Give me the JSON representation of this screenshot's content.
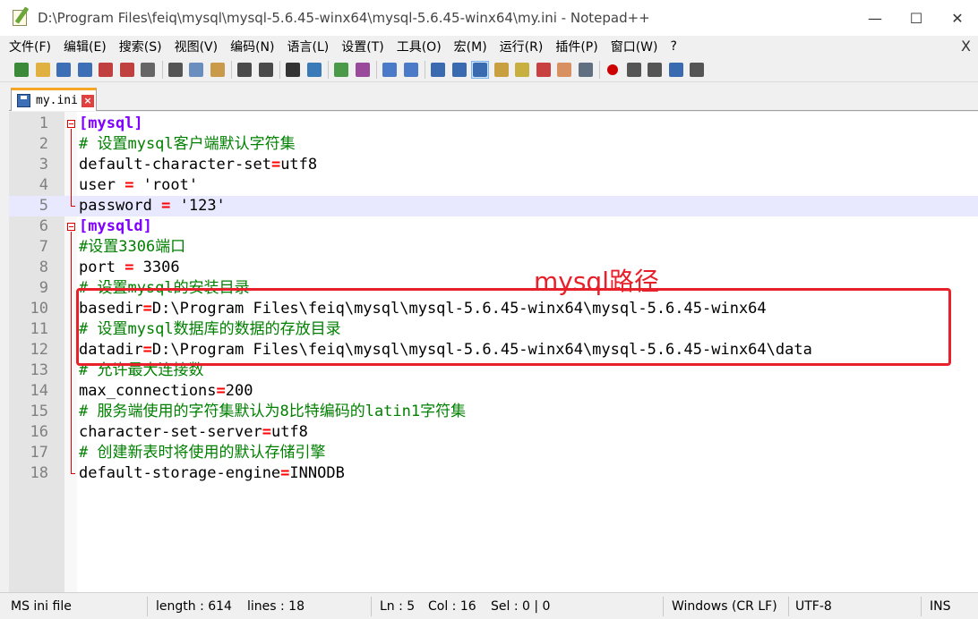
{
  "window": {
    "title": "D:\\Program Files\\feiq\\mysql\\mysql-5.6.45-winx64\\mysql-5.6.45-winx64\\my.ini - Notepad++",
    "minimize": "—",
    "maximize": "☐",
    "close": "✕"
  },
  "menu": {
    "items": [
      "文件(F)",
      "编辑(E)",
      "搜索(S)",
      "视图(V)",
      "编码(N)",
      "语言(L)",
      "设置(T)",
      "工具(O)",
      "宏(M)",
      "运行(R)",
      "插件(P)",
      "窗口(W)",
      "?"
    ],
    "close": "X"
  },
  "toolbar": {
    "icons": [
      {
        "name": "new-file-icon",
        "color": "#3a8a3a"
      },
      {
        "name": "open-file-icon",
        "color": "#e0b040"
      },
      {
        "name": "save-icon",
        "color": "#3d6fb6"
      },
      {
        "name": "save-all-icon",
        "color": "#3d6fb6"
      },
      {
        "name": "close-icon",
        "color": "#c04040"
      },
      {
        "name": "close-all-icon",
        "color": "#c04040"
      },
      {
        "name": "print-icon",
        "color": "#666666"
      },
      {
        "name": "cut-icon",
        "color": "#555555"
      },
      {
        "name": "copy-icon",
        "color": "#6a8fbf"
      },
      {
        "name": "paste-icon",
        "color": "#c89a4a"
      },
      {
        "name": "undo-icon",
        "color": "#4a4a4a"
      },
      {
        "name": "redo-icon",
        "color": "#4a4a4a"
      },
      {
        "name": "find-icon",
        "color": "#333333"
      },
      {
        "name": "replace-icon",
        "color": "#3a7ab8"
      },
      {
        "name": "zoom-in-icon",
        "color": "#4a9a4a"
      },
      {
        "name": "zoom-out-icon",
        "color": "#9a4a9a"
      },
      {
        "name": "sync-vertical-icon",
        "color": "#4a7ac8"
      },
      {
        "name": "sync-horizontal-icon",
        "color": "#4a7ac8"
      },
      {
        "name": "word-wrap-icon",
        "color": "#3a6ab0"
      },
      {
        "name": "show-all-chars-icon",
        "color": "#3a6ab0"
      },
      {
        "name": "indent-guide-icon",
        "color": "#3a6ab0"
      },
      {
        "name": "user-defined-lang-icon",
        "color": "#c8a040"
      },
      {
        "name": "doc-map-icon",
        "color": "#c8b040"
      },
      {
        "name": "function-list-icon",
        "color": "#c84040"
      },
      {
        "name": "folder-as-workspace-icon",
        "color": "#d89060"
      },
      {
        "name": "monitoring-icon",
        "color": "#607080"
      },
      {
        "name": "record-macro-icon",
        "color": "#cc0000"
      },
      {
        "name": "stop-macro-icon",
        "color": "#555555"
      },
      {
        "name": "play-macro-icon",
        "color": "#555555"
      },
      {
        "name": "run-macro-multiple-icon",
        "color": "#3a6ab0"
      },
      {
        "name": "save-macro-icon",
        "color": "#555555"
      }
    ]
  },
  "tab": {
    "label": "my.ini",
    "close": "×"
  },
  "editor": {
    "current_line": 5,
    "lines": [
      {
        "n": "1",
        "parts": [
          {
            "t": "[mysql]",
            "c": "section"
          }
        ]
      },
      {
        "n": "2",
        "parts": [
          {
            "t": "# 设置mysql客户端默认字符集",
            "c": "comment"
          }
        ]
      },
      {
        "n": "3",
        "parts": [
          {
            "t": "default-character-set",
            "c": "key"
          },
          {
            "t": "=",
            "c": "op"
          },
          {
            "t": "utf8",
            "c": "key"
          }
        ]
      },
      {
        "n": "4",
        "parts": [
          {
            "t": "user ",
            "c": "key"
          },
          {
            "t": "=",
            "c": "op"
          },
          {
            "t": " 'root'",
            "c": "key"
          }
        ]
      },
      {
        "n": "5",
        "parts": [
          {
            "t": "password ",
            "c": "key"
          },
          {
            "t": "=",
            "c": "op"
          },
          {
            "t": " '123'",
            "c": "key"
          }
        ]
      },
      {
        "n": "6",
        "parts": [
          {
            "t": "[mysqld]",
            "c": "section"
          }
        ]
      },
      {
        "n": "7",
        "parts": [
          {
            "t": "#设置3306端口",
            "c": "comment"
          }
        ]
      },
      {
        "n": "8",
        "parts": [
          {
            "t": "port ",
            "c": "key"
          },
          {
            "t": "=",
            "c": "op"
          },
          {
            "t": " 3306",
            "c": "key"
          }
        ]
      },
      {
        "n": "9",
        "parts": [
          {
            "t": "# 设置mysql的安装目录",
            "c": "comment"
          }
        ]
      },
      {
        "n": "10",
        "parts": [
          {
            "t": "basedir",
            "c": "key"
          },
          {
            "t": "=",
            "c": "op"
          },
          {
            "t": "D:\\Program Files\\feiq\\mysql\\mysql-5.6.45-winx64\\mysql-5.6.45-winx64",
            "c": "key"
          }
        ]
      },
      {
        "n": "11",
        "parts": [
          {
            "t": "# 设置mysql数据库的数据的存放目录",
            "c": "comment"
          }
        ]
      },
      {
        "n": "12",
        "parts": [
          {
            "t": "datadir",
            "c": "key"
          },
          {
            "t": "=",
            "c": "op"
          },
          {
            "t": "D:\\Program Files\\feiq\\mysql\\mysql-5.6.45-winx64\\mysql-5.6.45-winx64\\data",
            "c": "key"
          }
        ]
      },
      {
        "n": "13",
        "parts": [
          {
            "t": "# 允许最大连接数",
            "c": "comment"
          }
        ]
      },
      {
        "n": "14",
        "parts": [
          {
            "t": "max_connections",
            "c": "key"
          },
          {
            "t": "=",
            "c": "op"
          },
          {
            "t": "200",
            "c": "key"
          }
        ]
      },
      {
        "n": "15",
        "parts": [
          {
            "t": "# 服务端使用的字符集默认为8比特编码的latin1字符集",
            "c": "comment"
          }
        ]
      },
      {
        "n": "16",
        "parts": [
          {
            "t": "character-set-server",
            "c": "key"
          },
          {
            "t": "=",
            "c": "op"
          },
          {
            "t": "utf8",
            "c": "key"
          }
        ]
      },
      {
        "n": "17",
        "parts": [
          {
            "t": "# 创建新表时将使用的默认存储引擎",
            "c": "comment"
          }
        ]
      },
      {
        "n": "18",
        "parts": [
          {
            "t": "default-storage-engine",
            "c": "key"
          },
          {
            "t": "=",
            "c": "op"
          },
          {
            "t": "INNODB",
            "c": "key"
          }
        ]
      }
    ]
  },
  "annotation": {
    "label": "mysql路径",
    "color": "#e8202a"
  },
  "status": {
    "file_type": "MS ini file",
    "length": "length : 614",
    "lines": "lines : 18",
    "ln": "Ln : 5",
    "col": "Col : 16",
    "sel": "Sel : 0 | 0",
    "eol": "Windows (CR LF)",
    "encoding": "UTF-8",
    "mode": "INS"
  }
}
